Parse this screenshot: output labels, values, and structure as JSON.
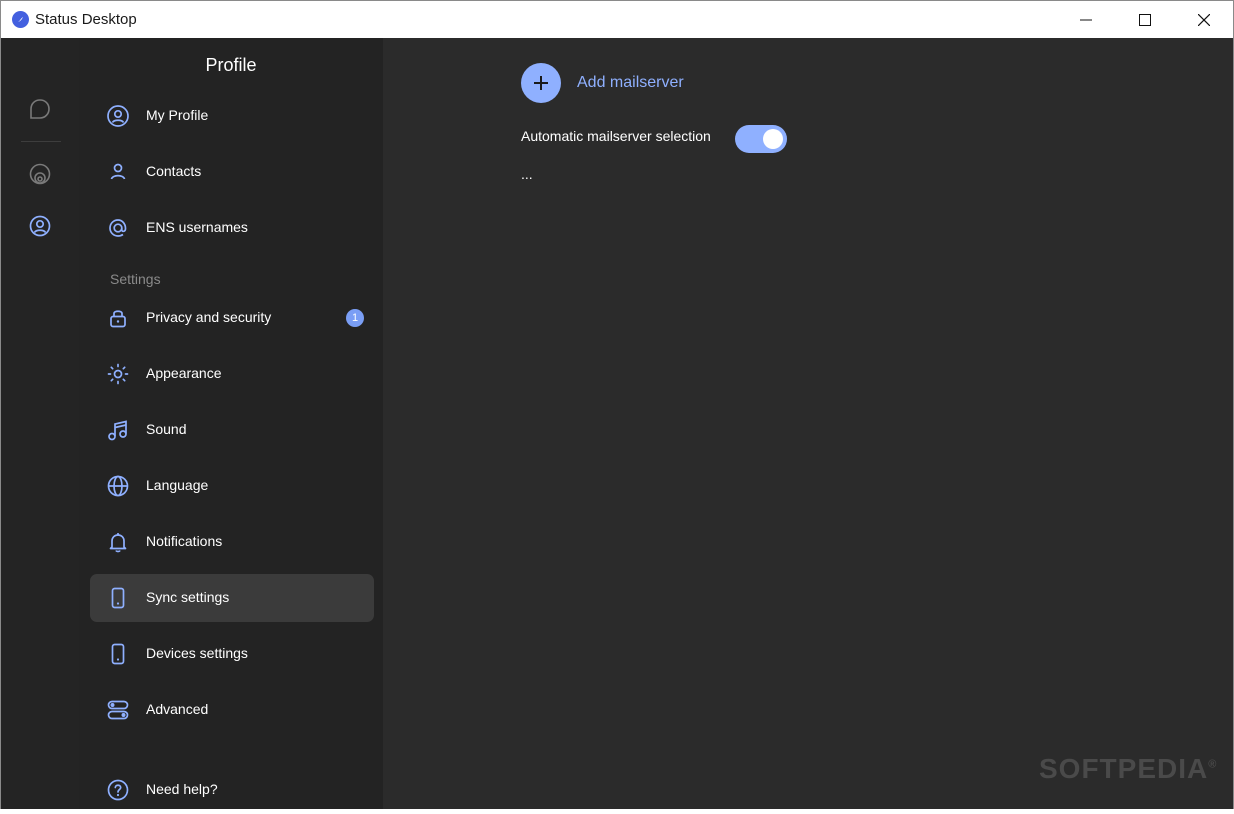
{
  "window": {
    "title": "Status Desktop",
    "controls": {
      "minimize": "minimize",
      "maximize": "maximize",
      "close": "close"
    }
  },
  "rail": {
    "icons": [
      "chat-icon",
      "wallet-icon",
      "profile-icon"
    ]
  },
  "sidebar": {
    "title": "Profile",
    "section_label": "Settings",
    "items": [
      {
        "label": "My Profile",
        "icon": "user-circle-icon"
      },
      {
        "label": "Contacts",
        "icon": "contact-icon"
      },
      {
        "label": "ENS usernames",
        "icon": "at-icon"
      },
      {
        "label": "Privacy and security",
        "icon": "lock-icon",
        "badge": "1"
      },
      {
        "label": "Appearance",
        "icon": "sun-icon"
      },
      {
        "label": "Sound",
        "icon": "music-note-icon"
      },
      {
        "label": "Language",
        "icon": "globe-icon"
      },
      {
        "label": "Notifications",
        "icon": "bell-icon"
      },
      {
        "label": "Sync settings",
        "icon": "phone-icon",
        "active": true
      },
      {
        "label": "Devices settings",
        "icon": "phone-icon"
      },
      {
        "label": "Advanced",
        "icon": "toggles-icon"
      },
      {
        "label": "Need help?",
        "icon": "question-icon"
      }
    ]
  },
  "main": {
    "add_mailserver_label": "Add mailserver",
    "auto_selection_label": "Automatic mailserver selection",
    "auto_selection_enabled": true,
    "ellipsis": "..."
  },
  "watermark": {
    "text": "SOFTPEDIA",
    "mark": "®"
  },
  "colors": {
    "accent": "#8fb0ff",
    "badge": "#7a9ef5",
    "sidebar_bg": "#232323",
    "rail_bg": "#242424",
    "main_bg": "#2b2b2b",
    "active_item_bg": "#3b3b3b"
  }
}
